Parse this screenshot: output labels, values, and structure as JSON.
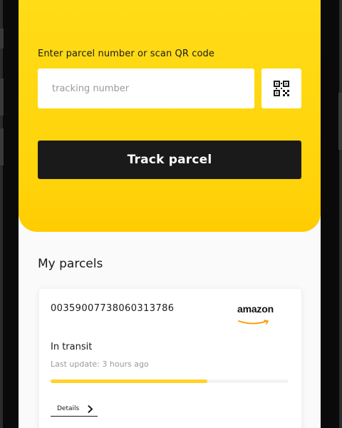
{
  "tracking_form": {
    "label": "Enter parcel number or scan QR code",
    "input_placeholder": "tracking number",
    "input_value": "",
    "qr_icon": "qr-code-icon",
    "track_button_label": "Track parcel"
  },
  "my_parcels": {
    "title": "My parcels",
    "items": [
      {
        "tracking_number": "00359007738060313786",
        "carrier": "amazon",
        "status": "In transit",
        "last_update": "Last update: 3 hours ago",
        "progress": 0.66,
        "details_label": "Details",
        "details_icon": "chevron-right-icon"
      }
    ]
  },
  "colors": {
    "accent": "#ffd30a",
    "button_dark": "#1a1a1a",
    "progress": "#ffd22a",
    "carrier_smile": "#ff9900"
  }
}
